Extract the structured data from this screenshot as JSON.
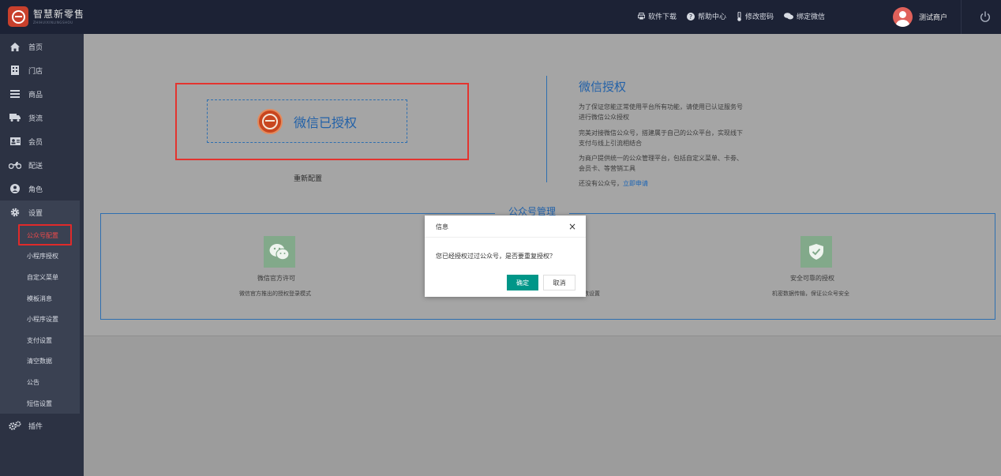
{
  "brand": {
    "title": "智慧新零售",
    "subtitle": "ZHIHUIXINLINGSHOU"
  },
  "topbar": {
    "links": [
      {
        "label": "软件下载",
        "icon": "printer-icon"
      },
      {
        "label": "帮助中心",
        "icon": "question-circle-icon"
      },
      {
        "label": "修改密码",
        "icon": "thermometer-icon"
      },
      {
        "label": "绑定微信",
        "icon": "chat-bubbles-icon"
      }
    ],
    "user_name": "测试商户",
    "power_icon": "power-icon"
  },
  "sidebar": {
    "items": [
      {
        "label": "首页",
        "icon": "home-icon"
      },
      {
        "label": "门店",
        "icon": "building-icon"
      },
      {
        "label": "商品",
        "icon": "list-icon"
      },
      {
        "label": "货流",
        "icon": "truck-icon"
      },
      {
        "label": "会员",
        "icon": "id-card-icon"
      },
      {
        "label": "配送",
        "icon": "motorcycle-icon"
      },
      {
        "label": "角色",
        "icon": "user-circle-icon"
      },
      {
        "label": "设置",
        "icon": "gear-icon"
      },
      {
        "label": "插件",
        "icon": "gears-icon"
      }
    ],
    "settings_sub": [
      "公众号配置",
      "小程序授权",
      "自定义菜单",
      "模板消息",
      "小程序设置",
      "支付设置",
      "清空数据",
      "公告",
      "短信设置"
    ],
    "active_sub": "公众号配置"
  },
  "auth": {
    "status": "微信已授权",
    "reconfig_label": "重新配置",
    "title": "微信授权",
    "paragraphs": [
      "为了保证您能正常使用平台所有功能，请使用已认证服务号进行微信公众授权",
      "完美对接微信公众号，搭建属于自己的公众平台，实现线下支付与线上引流相结合",
      "为商户提供统一的公众管理平台，包括自定义菜单、卡劵、会员卡、等营销工具"
    ],
    "no_account_text": "还没有公众号，",
    "apply_link": "立即申请"
  },
  "management": {
    "title": "公众号管理",
    "features": [
      {
        "name": "微信官方许可",
        "desc": "微信官方推出的授权登录模式",
        "icon": "wechat-icon"
      },
      {
        "name": "",
        "desc": "数设置",
        "icon": ""
      },
      {
        "name": "安全可靠的授权",
        "desc": "机密数据传输，保证公众号安全",
        "icon": "shield-check-icon"
      }
    ]
  },
  "modal": {
    "title": "信息",
    "close": "×",
    "message": "您已经授权过过公众号，是否要重复授权？",
    "confirm": "确定",
    "cancel": "取消"
  },
  "colors": {
    "topbar_bg": "#1c2235",
    "sidebar_bg": "#2c3243",
    "accent_blue": "#2261a8",
    "highlight_red": "#e3342f",
    "confirm_green": "#009688",
    "feature_icon_green": "#82a98a"
  }
}
